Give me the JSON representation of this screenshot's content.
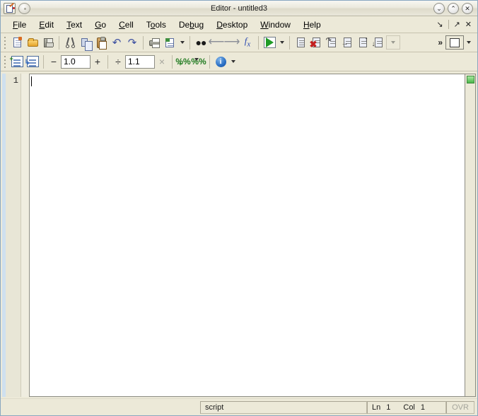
{
  "window": {
    "title": "Editor - untitled3",
    "app_icon": "editor-document-pencil-icon",
    "round_icon": "window-menu-icon",
    "buttons": [
      {
        "name": "minimize",
        "glyph": "⌄"
      },
      {
        "name": "maximize",
        "glyph": "⌃"
      },
      {
        "name": "close",
        "glyph": "✕"
      }
    ]
  },
  "menubar": {
    "items": [
      {
        "pre": "",
        "mnemonic": "F",
        "post": "ile",
        "name": "file"
      },
      {
        "pre": "",
        "mnemonic": "E",
        "post": "dit",
        "name": "edit"
      },
      {
        "pre": "",
        "mnemonic": "T",
        "post": "ext",
        "name": "text"
      },
      {
        "pre": "",
        "mnemonic": "G",
        "post": "o",
        "name": "go"
      },
      {
        "pre": "",
        "mnemonic": "C",
        "post": "ell",
        "name": "cell"
      },
      {
        "pre": "T",
        "mnemonic": "o",
        "post": "ols",
        "name": "tools"
      },
      {
        "pre": "De",
        "mnemonic": "b",
        "post": "ug",
        "name": "debug"
      },
      {
        "pre": "",
        "mnemonic": "D",
        "post": "esktop",
        "name": "desktop"
      },
      {
        "pre": "",
        "mnemonic": "W",
        "post": "indow",
        "name": "window"
      },
      {
        "pre": "",
        "mnemonic": "H",
        "post": "elp",
        "name": "help"
      }
    ],
    "right": {
      "dock": "↘",
      "undock": "↗",
      "close": "✕"
    }
  },
  "toolbar_main": {
    "buttons": [
      {
        "name": "new-file-button",
        "icon": "new-document-icon"
      },
      {
        "name": "open-file-button",
        "icon": "open-folder-icon"
      },
      {
        "name": "save-file-button",
        "icon": "save-floppy-icon"
      },
      {
        "name": "cut-button",
        "icon": "scissors-icon"
      },
      {
        "name": "copy-button",
        "icon": "copy-icon"
      },
      {
        "name": "paste-button",
        "icon": "clipboard-paste-icon"
      },
      {
        "name": "undo-button",
        "icon": "undo-arrow-icon"
      },
      {
        "name": "redo-button",
        "icon": "redo-arrow-icon"
      },
      {
        "name": "print-button",
        "icon": "printer-icon"
      },
      {
        "name": "print-preview-button",
        "icon": "print-preview-icon"
      },
      {
        "name": "find-button",
        "icon": "binoculars-icon"
      },
      {
        "name": "back-button",
        "icon": "arrow-left-icon"
      },
      {
        "name": "forward-button",
        "icon": "arrow-right-icon"
      },
      {
        "name": "function-browser-button",
        "icon": "fx-icon"
      },
      {
        "name": "run-button",
        "icon": "run-play-icon"
      },
      {
        "name": "set-breakpoint-button",
        "icon": "breakpoint-icon"
      },
      {
        "name": "clear-breakpoints-button",
        "icon": "clear-breakpoints-icon"
      },
      {
        "name": "step-button",
        "icon": "step-icon"
      },
      {
        "name": "step-in-button",
        "icon": "step-in-icon"
      },
      {
        "name": "step-out-button",
        "icon": "step-out-icon"
      },
      {
        "name": "continue-button",
        "icon": "continue-icon"
      },
      {
        "name": "stack-dropdown",
        "icon": "chevron-down-icon"
      }
    ],
    "overflow": "»",
    "layout_button": "layout-square-icon"
  },
  "toolbar_cell": {
    "insert_cell": "insert-cell-icon",
    "insert_cell_divider": "insert-cell-divider-icon",
    "minus": "−",
    "value_decrement": "1.0",
    "plus": "+",
    "divide": "÷",
    "value_divide": "1.1",
    "multiply": "×",
    "eval_cell": "%%",
    "eval_cell_advance": "%%",
    "info": "i"
  },
  "editor": {
    "line_numbers": [
      "1"
    ],
    "content": "",
    "analyzer_status": "ok"
  },
  "statusbar": {
    "file_type": "script",
    "line_label": "Ln",
    "line_value": "1",
    "col_label": "Col",
    "col_value": "1",
    "overwrite": "OVR"
  },
  "colors": {
    "chrome": "#ece9d8",
    "editor_bg": "#ffffff",
    "analyzer_ok": "#49b549",
    "accent_blue": "#2a6fc4",
    "run_green": "#1f9b26"
  }
}
